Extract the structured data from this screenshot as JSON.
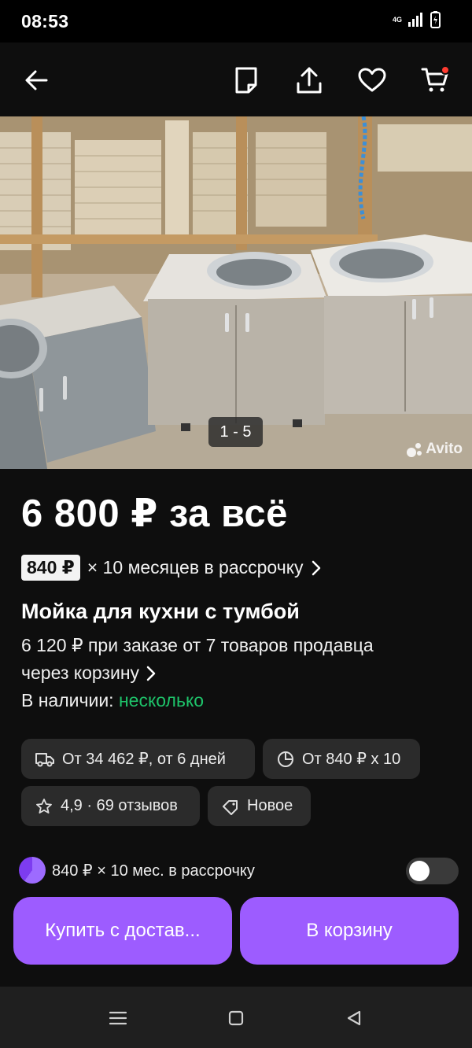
{
  "status_bar": {
    "time": "08:53",
    "network": "4G"
  },
  "app_bar": {
    "icons": [
      "back-arrow-icon",
      "note-icon",
      "share-icon",
      "heart-icon",
      "cart-icon"
    ]
  },
  "gallery": {
    "counter": "1 - 5",
    "watermark": "Avito"
  },
  "product": {
    "price": "6 800 ₽ за всё",
    "installment_badge": "840 ₽",
    "installment_text": "× 10 месяцев в рассрочку",
    "title": "Мойка для кухни с тумбой",
    "bulk_offer_line1": "6 120 ₽ при заказе от 7 товаров продавца",
    "bulk_offer_line2": "через корзину",
    "stock_label": "В наличии:",
    "stock_value": "несколько"
  },
  "chips": {
    "delivery": "От 34 462 ₽, от 6 дней",
    "installment": "От 840 ₽ x 10",
    "rating": "4,9 · 69 отзывов",
    "condition": "Новое"
  },
  "installment_toggle": {
    "label": "840 ₽ × 10 мес. в рассрочку",
    "enabled": false
  },
  "buttons": {
    "buy_delivery": "Купить с достав...",
    "add_to_cart": "В корзину"
  },
  "colors": {
    "accent": "#9d5cff",
    "stock_green": "#1ec36a",
    "cart_badge": "#ff3b30"
  }
}
